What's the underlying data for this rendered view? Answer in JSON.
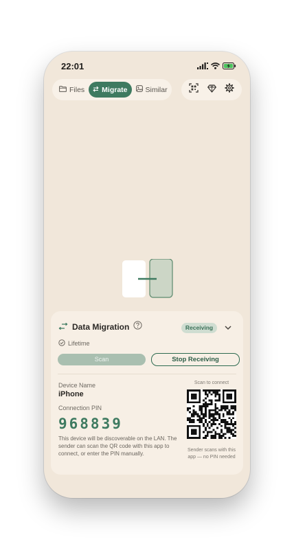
{
  "status": {
    "time": "22:01"
  },
  "tabs": [
    {
      "label": "Files",
      "icon": "folder-icon",
      "active": false
    },
    {
      "label": "Migrate",
      "icon": "swap-icon",
      "active": true
    },
    {
      "label": "Similar",
      "icon": "image-icon",
      "active": false
    }
  ],
  "toolbar": {
    "icons": [
      "qr-scan-icon",
      "diamond-icon",
      "gear-icon"
    ]
  },
  "panel": {
    "title": "Data Migration",
    "status_badge": "Receiving",
    "plan": "Lifetime",
    "scan_label": "Scan",
    "stop_label": "Stop Receiving",
    "device_name_label": "Device Name",
    "device_name": "iPhone",
    "pin_label": "Connection PIN",
    "pin": "968839",
    "description": "This device will be discoverable on the LAN. The sender can scan the QR code with this app to connect, or enter the PIN manually.",
    "scan_to_connect": "Scan to connect",
    "qr_note": "Sender scans with this app — no PIN needed"
  },
  "colors": {
    "accent": "#3e7a60",
    "background": "#f1e7da",
    "panel": "#f7efe5",
    "badge_bg": "#cfddd1"
  }
}
